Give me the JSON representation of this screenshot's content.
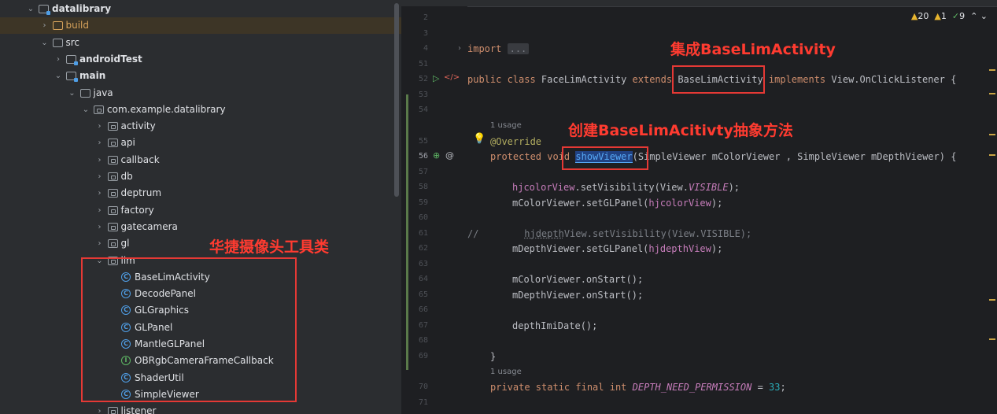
{
  "tree": {
    "items": [
      {
        "label": "datalibrary",
        "depth": 0,
        "expanded": true,
        "icon": "module-folder-icon"
      },
      {
        "label": "build",
        "depth": 1,
        "expanded": false,
        "icon": "folder-icon",
        "excluded": true
      },
      {
        "label": "src",
        "depth": 1,
        "expanded": true,
        "icon": "folder-icon"
      },
      {
        "label": "androidTest",
        "depth": 2,
        "expanded": false,
        "icon": "test-source-folder-icon"
      },
      {
        "label": "main",
        "depth": 2,
        "expanded": true,
        "icon": "source-folder-icon"
      },
      {
        "label": "java",
        "depth": 3,
        "expanded": true,
        "icon": "folder-icon"
      },
      {
        "label": "com.example.datalibrary",
        "depth": 4,
        "expanded": true,
        "icon": "package-icon"
      },
      {
        "label": "activity",
        "depth": 5,
        "expanded": false,
        "icon": "package-icon"
      },
      {
        "label": "api",
        "depth": 5,
        "expanded": false,
        "icon": "package-icon"
      },
      {
        "label": "callback",
        "depth": 5,
        "expanded": false,
        "icon": "package-icon"
      },
      {
        "label": "db",
        "depth": 5,
        "expanded": false,
        "icon": "package-icon"
      },
      {
        "label": "deptrum",
        "depth": 5,
        "expanded": false,
        "icon": "package-icon"
      },
      {
        "label": "factory",
        "depth": 5,
        "expanded": false,
        "icon": "package-icon"
      },
      {
        "label": "gatecamera",
        "depth": 5,
        "expanded": false,
        "icon": "package-icon"
      },
      {
        "label": "gl",
        "depth": 5,
        "expanded": false,
        "icon": "package-icon"
      },
      {
        "label": "lim",
        "depth": 5,
        "expanded": true,
        "icon": "package-icon"
      },
      {
        "label": "BaseLimActivity",
        "depth": 6,
        "icon": "class-icon"
      },
      {
        "label": "DecodePanel",
        "depth": 6,
        "icon": "class-icon"
      },
      {
        "label": "GLGraphics",
        "depth": 6,
        "icon": "class-icon"
      },
      {
        "label": "GLPanel",
        "depth": 6,
        "icon": "class-icon"
      },
      {
        "label": "MantleGLPanel",
        "depth": 6,
        "icon": "class-icon"
      },
      {
        "label": "OBRgbCameraFrameCallback",
        "depth": 6,
        "icon": "interface-icon"
      },
      {
        "label": "ShaderUtil",
        "depth": 6,
        "icon": "class-icon"
      },
      {
        "label": "SimpleViewer",
        "depth": 6,
        "icon": "class-icon"
      },
      {
        "label": "listener",
        "depth": 5,
        "expanded": false,
        "icon": "package-icon"
      }
    ]
  },
  "editor": {
    "inspections": {
      "warnings": "20",
      "weak_warnings": "1",
      "typos": "9"
    },
    "import_fold": "...",
    "usage_hint_1": "1 usage",
    "usage_hint_2": "1 usage",
    "lines": {
      "l2": "2",
      "l3": "3",
      "l4": "4",
      "l51": "51",
      "l52": "52",
      "l53": "53",
      "l54": "54",
      "l55": "55",
      "l56": "56",
      "l57": "57",
      "l58": "58",
      "l59": "59",
      "l60": "60",
      "l61": "61",
      "l62": "62",
      "l63": "63",
      "l64": "64",
      "l65": "65",
      "l66": "66",
      "l67": "67",
      "l68": "68",
      "l69": "69",
      "l70": "70",
      "l71": "71"
    },
    "code": {
      "import_kw": "import",
      "public_class": "public class ",
      "class_name": "FaceLimActivity ",
      "extends_kw": "extends ",
      "base_class": "BaseLimActivity",
      "implements_kw": " implements ",
      "iface": "View.OnClickListener {",
      "override": "@Override",
      "protected_void": "protected void ",
      "method": "showViewer",
      "params": "(SimpleViewer mColorViewer , SimpleViewer mDepthViewer) {",
      "l58_a": "hjcolorView",
      "l58_b": ".setVisibility(View.",
      "l58_c": "VISIBLE",
      "l58_d": ");",
      "l59_a": "mColorViewer.setGLPanel(",
      "l59_b": "hjcolorView",
      "l59_c": ");",
      "l61": "//        hjdepthView.setVisibility(View.VISIBLE);",
      "l61_slash": "//",
      "l61_field": "hjdepth",
      "l61_rest": "View.setVisibility(View.VISIBLE);",
      "l62_a": "mDepthViewer.setGLPanel(",
      "l62_b": "hjdepthView",
      "l62_c": ");",
      "l64": "mColorViewer.onStart();",
      "l65": "mDepthViewer.onStart();",
      "l67": "depthImiDate();",
      "l69": "}",
      "l70_kw": "private static final int ",
      "l70_const": "DEPTH_NEED_PERMISSION",
      "l70_eq": " = ",
      "l70_num": "33",
      "l70_end": ";"
    }
  },
  "annotations": {
    "extends_note": "集成BaseLimActivity",
    "abstract_note": "创建BaseLimAcitivty抽象方法",
    "camera_note": "华捷摄像头工具类"
  },
  "colors": {
    "annotation_red": "#e53935",
    "accent_blue": "#56a8f5"
  }
}
